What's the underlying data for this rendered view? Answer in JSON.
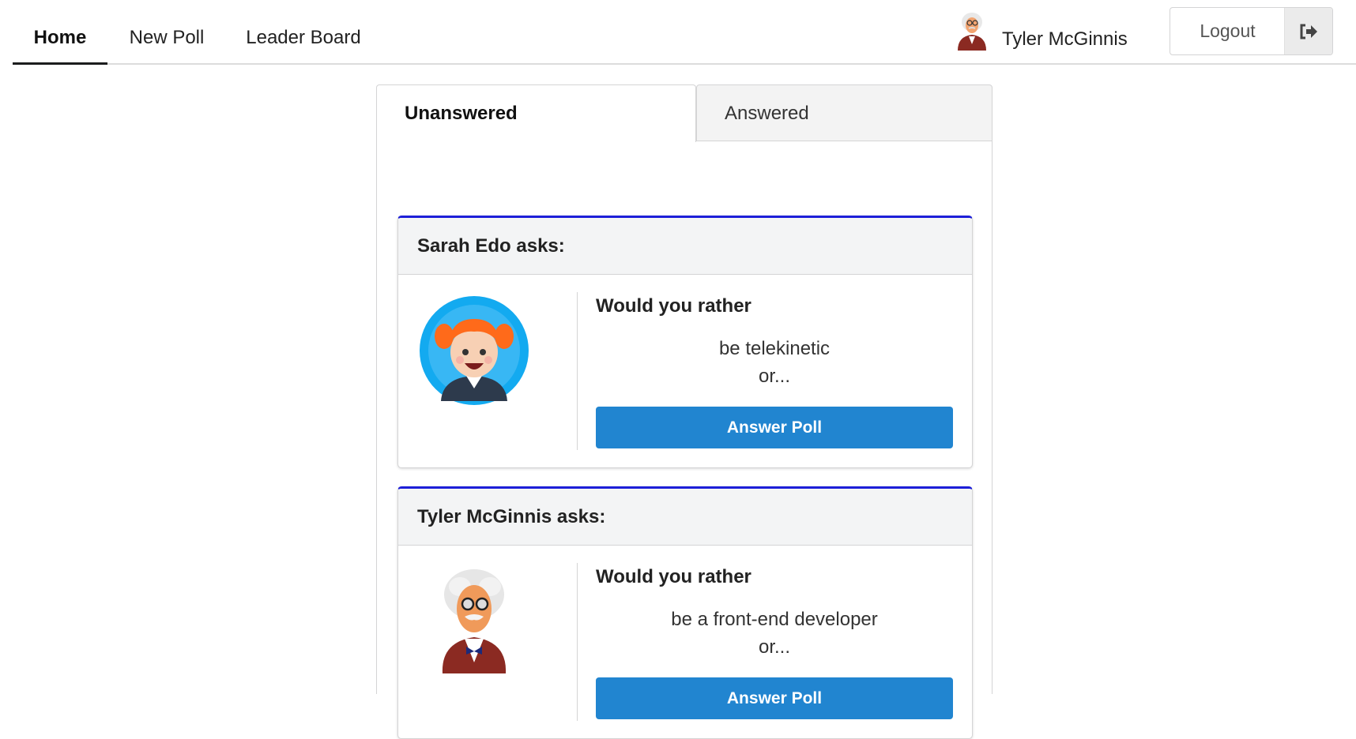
{
  "nav": {
    "items": [
      {
        "label": "Home",
        "active": true
      },
      {
        "label": "New Poll",
        "active": false
      },
      {
        "label": "Leader Board",
        "active": false
      }
    ],
    "user_name": "Tyler McGinnis",
    "logout_label": "Logout",
    "logout_icon": "sign-out-icon"
  },
  "tabs": [
    {
      "label": "Unanswered",
      "active": true
    },
    {
      "label": "Answered",
      "active": false
    }
  ],
  "questions": [
    {
      "asker": "Sarah Edo asks:",
      "avatar": "girl-avatar",
      "title": "Would you rather",
      "option": "be telekinetic",
      "or": "or...",
      "button": "Answer Poll"
    },
    {
      "asker": "Tyler McGinnis asks:",
      "avatar": "professor-avatar",
      "title": "Would you rather",
      "option": "be a front-end developer",
      "or": "or...",
      "button": "Answer Poll"
    }
  ],
  "colors": {
    "accent": "#2185d0",
    "card_top_border": "#1d1fd8",
    "header_bg": "#f3f4f5"
  }
}
